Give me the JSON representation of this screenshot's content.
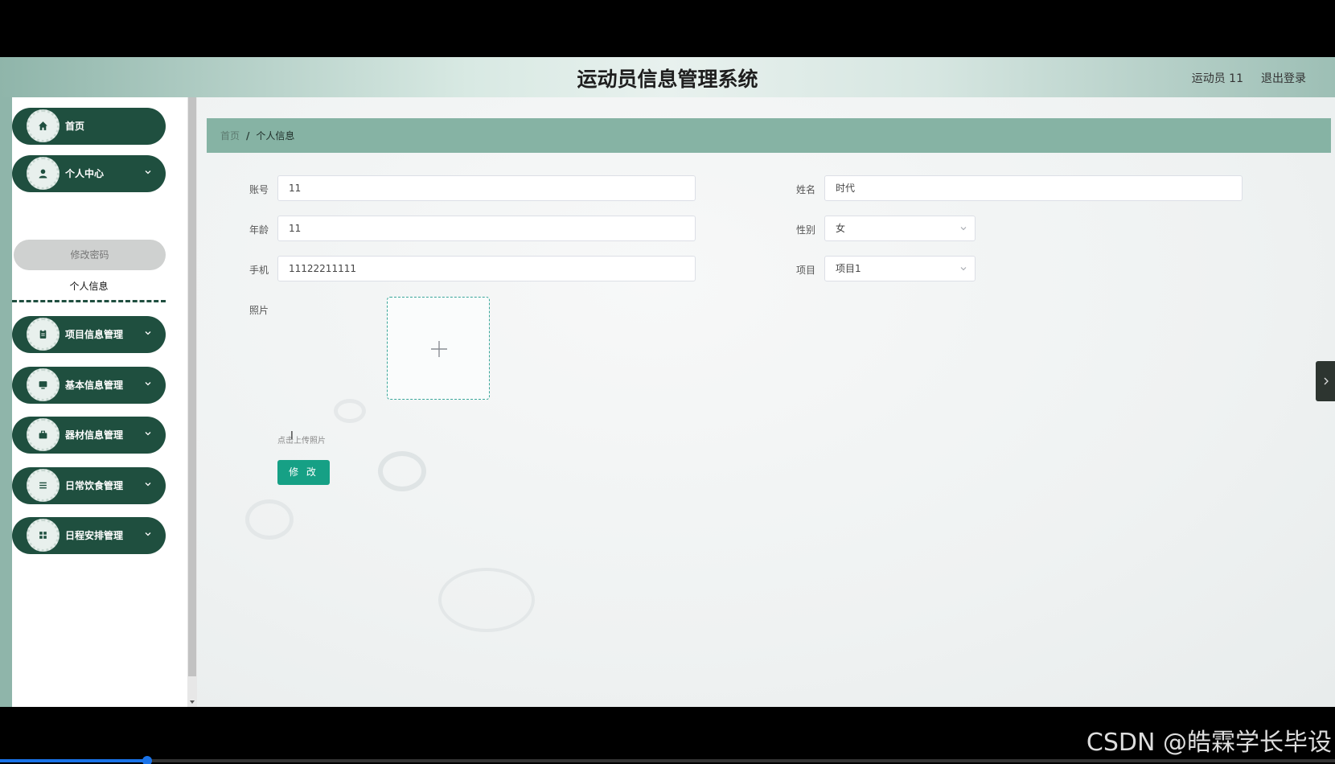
{
  "header": {
    "title": "运动员信息管理系统",
    "user_label": "运动员 11",
    "logout_label": "退出登录"
  },
  "sidebar": {
    "items": [
      {
        "label": "首页",
        "icon": "home-icon"
      },
      {
        "label": "个人中心",
        "icon": "user-icon"
      },
      {
        "label": "项目信息管理",
        "icon": "clipboard-icon"
      },
      {
        "label": "基本信息管理",
        "icon": "monitor-icon"
      },
      {
        "label": "器材信息管理",
        "icon": "briefcase-icon"
      },
      {
        "label": "日常饮食管理",
        "icon": "list-icon"
      },
      {
        "label": "日程安排管理",
        "icon": "grid-icon"
      }
    ],
    "submenu": [
      {
        "label": "修改密码"
      },
      {
        "label": "个人信息"
      }
    ]
  },
  "breadcrumb": {
    "home": "首页",
    "separator": "/",
    "current": "个人信息"
  },
  "form": {
    "account": {
      "label": "账号",
      "value": "11"
    },
    "name": {
      "label": "姓名",
      "value": "时代"
    },
    "age": {
      "label": "年龄",
      "value": "11"
    },
    "gender": {
      "label": "性别",
      "value": "女"
    },
    "phone": {
      "label": "手机",
      "value": "11122211111"
    },
    "project": {
      "label": "项目",
      "value": "项目1"
    },
    "photo": {
      "label": "照片",
      "tip": "点击上传照片"
    },
    "submit_label": "修 改"
  },
  "watermark": "CSDN @皓霖学长毕设",
  "video_progress": 0.11,
  "colors": {
    "accent": "#16a085",
    "sidebar_item": "#1f4f3f",
    "breadcrumb_bg": "#86b3a4"
  }
}
